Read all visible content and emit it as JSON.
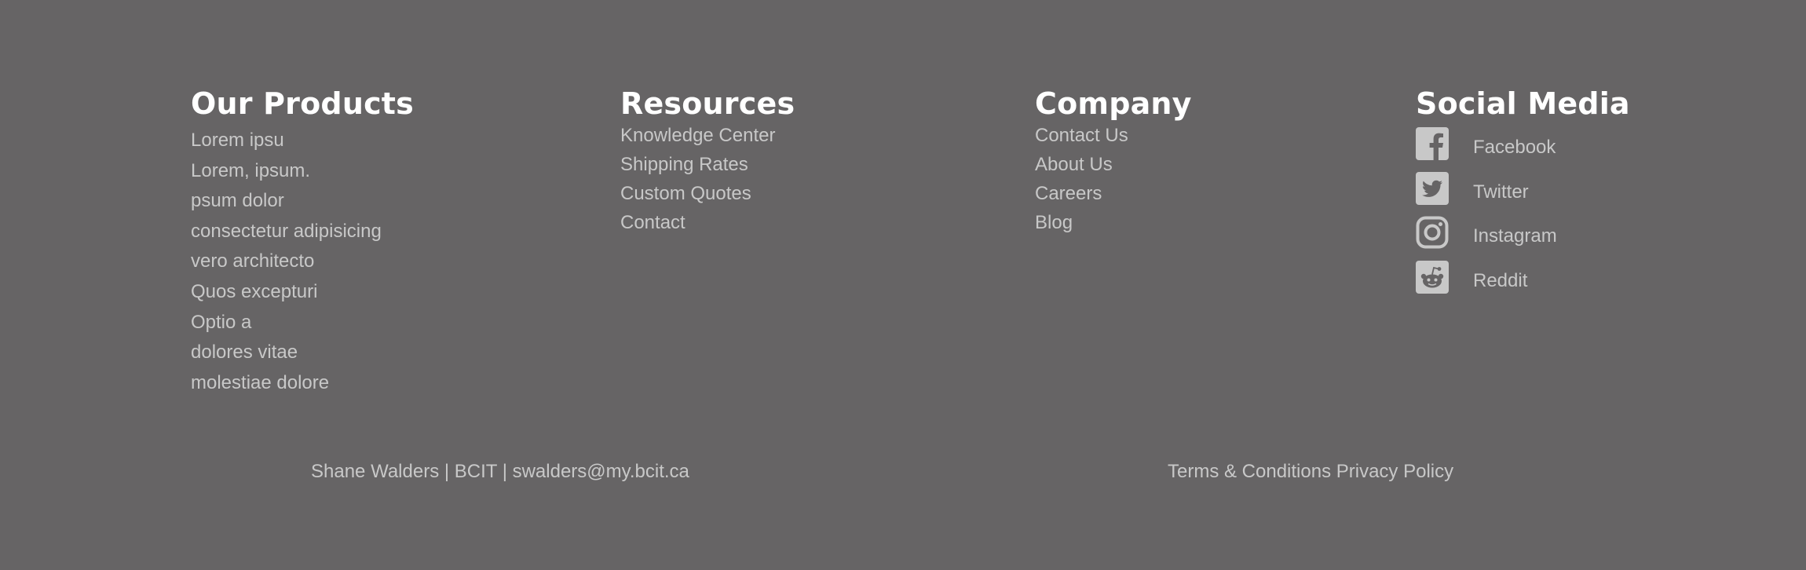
{
  "colors": {
    "background": "#666465",
    "heading": "#ffffff",
    "link": "#c8c8c8",
    "icon": "#c8c8c8"
  },
  "products": {
    "title": "Our Products",
    "items": [
      "Lorem ipsu",
      "Lorem, ipsum.",
      "psum dolor",
      "consectetur adipisicing",
      "vero architecto",
      "Quos excepturi",
      "Optio a",
      "dolores vitae",
      "molestiae dolore"
    ]
  },
  "resources": {
    "title": "Resources",
    "items": [
      "Knowledge Center",
      "Shipping Rates",
      "Custom Quotes",
      "Contact"
    ]
  },
  "company": {
    "title": "Company",
    "items": [
      "Contact Us",
      "About Us",
      "Careers",
      "Blog"
    ]
  },
  "social": {
    "title": "Social Media",
    "items": [
      {
        "label": "Facebook",
        "icon": "facebook-icon"
      },
      {
        "label": "Twitter",
        "icon": "twitter-icon"
      },
      {
        "label": "Instagram",
        "icon": "instagram-icon"
      },
      {
        "label": "Reddit",
        "icon": "reddit-icon"
      }
    ]
  },
  "bottom": {
    "name": "Shane Walders",
    "separator": "|",
    "school": "BCIT",
    "email": "swalders@my.bcit.ca",
    "terms": "Terms & Conditions",
    "privacy": "Privacy Policy"
  }
}
